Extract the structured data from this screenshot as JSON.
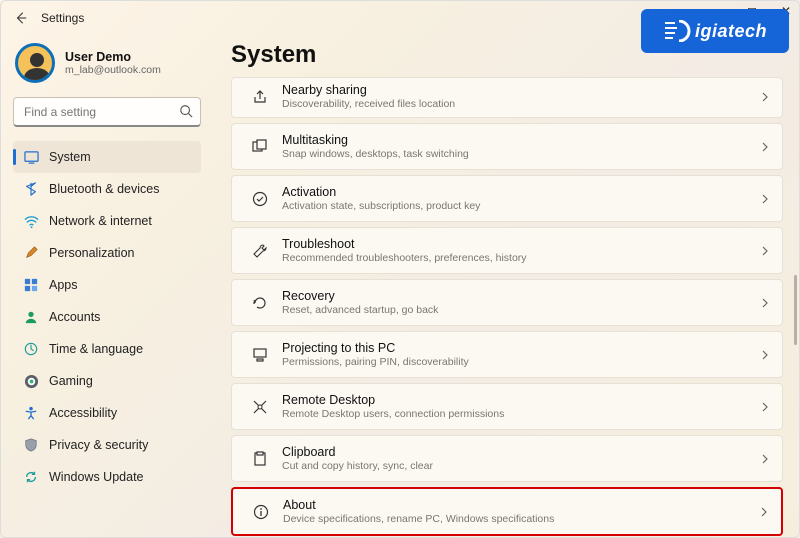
{
  "window": {
    "title": "Settings"
  },
  "user": {
    "name": "User Demo",
    "email": "m_lab@outlook.com"
  },
  "search": {
    "placeholder": "Find a setting"
  },
  "watermark": {
    "text": "igiatech"
  },
  "sidebar": {
    "items": [
      {
        "label": "System"
      },
      {
        "label": "Bluetooth & devices"
      },
      {
        "label": "Network & internet"
      },
      {
        "label": "Personalization"
      },
      {
        "label": "Apps"
      },
      {
        "label": "Accounts"
      },
      {
        "label": "Time & language"
      },
      {
        "label": "Gaming"
      },
      {
        "label": "Accessibility"
      },
      {
        "label": "Privacy & security"
      },
      {
        "label": "Windows Update"
      }
    ]
  },
  "page": {
    "title": "System"
  },
  "cards": [
    {
      "title": "Nearby sharing",
      "sub": "Discoverability, received files location"
    },
    {
      "title": "Multitasking",
      "sub": "Snap windows, desktops, task switching"
    },
    {
      "title": "Activation",
      "sub": "Activation state, subscriptions, product key"
    },
    {
      "title": "Troubleshoot",
      "sub": "Recommended troubleshooters, preferences, history"
    },
    {
      "title": "Recovery",
      "sub": "Reset, advanced startup, go back"
    },
    {
      "title": "Projecting to this PC",
      "sub": "Permissions, pairing PIN, discoverability"
    },
    {
      "title": "Remote Desktop",
      "sub": "Remote Desktop users, connection permissions"
    },
    {
      "title": "Clipboard",
      "sub": "Cut and copy history, sync, clear"
    },
    {
      "title": "About",
      "sub": "Device specifications, rename PC, Windows specifications"
    }
  ]
}
